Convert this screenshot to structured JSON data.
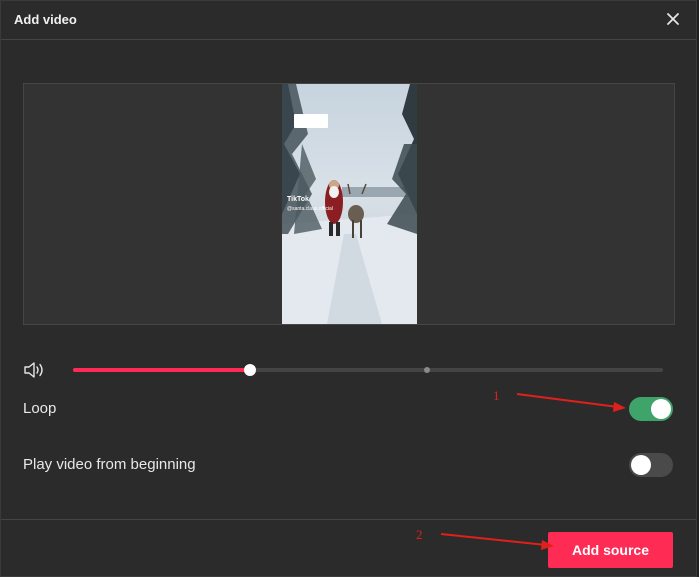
{
  "dialog": {
    "title": "Add video"
  },
  "video": {
    "watermark": "TikTok",
    "watermark_handle": "@santa.claus.official"
  },
  "volume": {
    "level_percent": 30
  },
  "progress": {
    "buffered_percent": 60
  },
  "options": [
    {
      "label": "Loop",
      "enabled": true
    },
    {
      "label": "Play video from beginning",
      "enabled": false
    }
  ],
  "footer": {
    "add_source_label": "Add source"
  },
  "annotations": [
    {
      "label": "1"
    },
    {
      "label": "2"
    }
  ],
  "colors": {
    "accent": "#fe2c55",
    "toggle_on": "#3fa46a",
    "toggle_off": "#4a4a4a",
    "annotation": "#e0201c"
  },
  "icons": {
    "close": "close-icon",
    "volume": "volume-icon"
  }
}
